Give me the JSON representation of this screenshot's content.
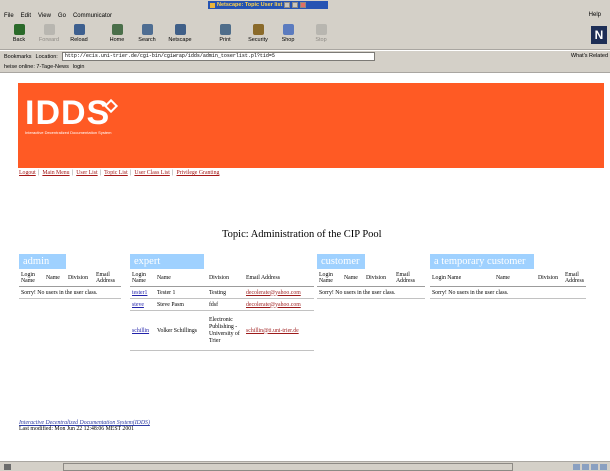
{
  "window": {
    "title": "Netscape: Topic User list",
    "right_text": ""
  },
  "menu": {
    "items": [
      "File",
      "Edit",
      "View",
      "Go",
      "Communicator"
    ],
    "help": "Help"
  },
  "toolbar": {
    "buttons": [
      {
        "label": "Back",
        "icon": "back-arrow-icon",
        "enabled": true
      },
      {
        "label": "Forward",
        "icon": "forward-arrow-icon",
        "enabled": false
      },
      {
        "label": "Reload",
        "icon": "reload-icon",
        "enabled": true
      },
      {
        "label": "Home",
        "icon": "home-icon",
        "enabled": true
      },
      {
        "label": "Search",
        "icon": "search-icon",
        "enabled": true
      },
      {
        "label": "Netscape",
        "icon": "netscape-icon",
        "enabled": true
      },
      {
        "label": "Print",
        "icon": "print-icon",
        "enabled": true
      },
      {
        "label": "Security",
        "icon": "lock-icon",
        "enabled": true
      },
      {
        "label": "Shop",
        "icon": "shop-icon",
        "enabled": true
      },
      {
        "label": "Stop",
        "icon": "stop-icon",
        "enabled": false
      }
    ]
  },
  "location": {
    "bookmarks_label": "Bookmarks",
    "location_label": "Location:",
    "url": "http://ecis.uni-trier.de/cgi-bin/cgiwrap/idds/admin_toserlist.pl?tid=5",
    "related": "What's Related"
  },
  "personal": {
    "items": [
      "heise online: 7-Tage-News",
      "login"
    ]
  },
  "page": {
    "logo": "IDDS",
    "tagline": "Interactive Decentralized Documentation System",
    "nav_links": [
      "Logout",
      "Main Menu",
      "User List",
      "Topic List",
      "User Class List",
      "Privilege Granting"
    ],
    "title": "Topic: Administration of the CIP Pool",
    "panels": [
      {
        "title": "admin",
        "columns": [
          "Login Name",
          "Name",
          "Division",
          "Email Address"
        ],
        "message": "Sorry! No users in the user class.",
        "rows": []
      },
      {
        "title": "expert",
        "columns": [
          "Login Name",
          "Name",
          "Division",
          "Email Address"
        ],
        "message": "",
        "rows": [
          [
            "tester1",
            "Tester 1",
            "Testing",
            "decolerate@yahoo.com"
          ],
          [
            "steve",
            "Steve Pasm",
            "fdsf",
            "decolerate@yahoo.com"
          ],
          [
            "schillin",
            "Volker Schillings",
            "Electronic Publishing - University of Trier",
            "schillin@ti.uni-trier.de"
          ]
        ]
      },
      {
        "title": "customer",
        "columns": [
          "Login Name",
          "Name",
          "Division",
          "Email Address"
        ],
        "message": "Sorry! No users in the user class.",
        "rows": []
      },
      {
        "title": "a temporary customer",
        "columns": [
          "Login Name",
          "Name",
          "Division",
          "Email Address"
        ],
        "message": "Sorry! No users in the user class.",
        "rows": []
      }
    ],
    "footer_link": "Interactive Decentralized Documentation System(IDDS)",
    "last_modified": "Last modified: Mon Jun 22 12:48:06 MEST 2001"
  },
  "colors": {
    "banner": "#ff5a24",
    "panel_header": "#9fd1ff",
    "chrome": "#d4d0c8"
  }
}
